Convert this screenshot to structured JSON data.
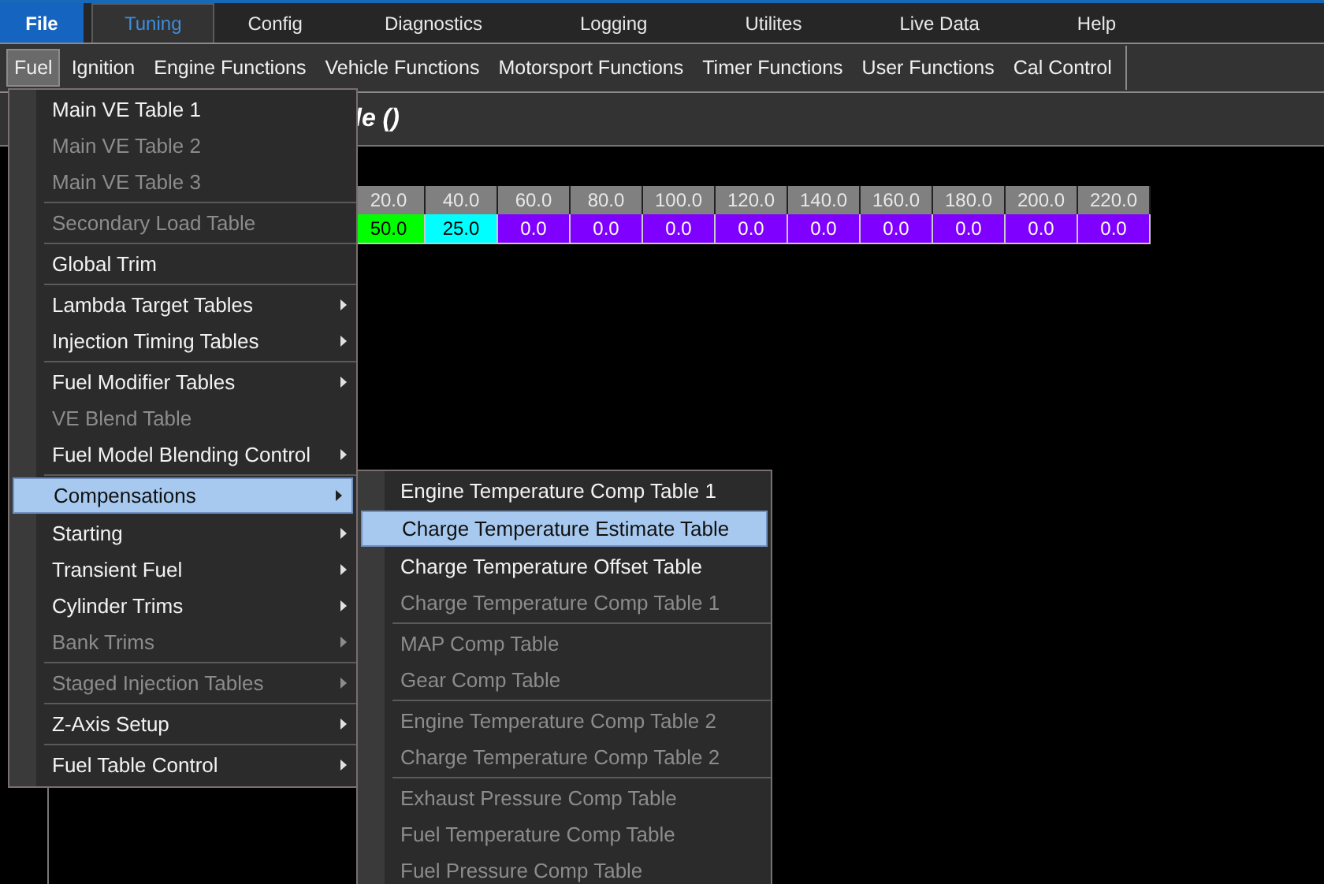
{
  "tabs": [
    {
      "label": "File",
      "kind": "file",
      "selected": false
    },
    {
      "label": "Tuning",
      "kind": "tab",
      "selected": true
    },
    {
      "label": "Config",
      "kind": "tab",
      "selected": false
    },
    {
      "label": "Diagnostics",
      "kind": "tab",
      "selected": false
    },
    {
      "label": "Logging",
      "kind": "tab",
      "selected": false
    },
    {
      "label": "Utilites",
      "kind": "tab",
      "selected": false
    },
    {
      "label": "Live Data",
      "kind": "tab",
      "selected": false
    },
    {
      "label": "Help",
      "kind": "tab",
      "selected": false
    }
  ],
  "ribbon": {
    "items": [
      {
        "label": "Fuel",
        "selected": true
      },
      {
        "label": "Ignition",
        "selected": false
      },
      {
        "label": "Engine Functions",
        "selected": false
      },
      {
        "label": "Vehicle Functions",
        "selected": false
      },
      {
        "label": "Motorsport Functions",
        "selected": false
      },
      {
        "label": "Timer Functions",
        "selected": false
      },
      {
        "label": "User Functions",
        "selected": false
      },
      {
        "label": "Cal Control",
        "selected": false
      }
    ]
  },
  "document": {
    "title": "le ()"
  },
  "table": {
    "columns": [
      "20.0",
      "40.0",
      "60.0",
      "80.0",
      "100.0",
      "120.0",
      "140.0",
      "160.0",
      "180.0",
      "200.0",
      "220.0"
    ],
    "cells": [
      {
        "value": "50.0",
        "color": "#00ff00"
      },
      {
        "value": "25.0",
        "color": "#00ffff"
      },
      {
        "value": "0.0",
        "color": "#8000ff"
      },
      {
        "value": "0.0",
        "color": "#8000ff"
      },
      {
        "value": "0.0",
        "color": "#8000ff"
      },
      {
        "value": "0.0",
        "color": "#8000ff"
      },
      {
        "value": "0.0",
        "color": "#8000ff"
      },
      {
        "value": "0.0",
        "color": "#8000ff"
      },
      {
        "value": "0.0",
        "color": "#8000ff"
      },
      {
        "value": "0.0",
        "color": "#8000ff"
      },
      {
        "value": "0.0",
        "color": "#8000ff"
      }
    ]
  },
  "fuel_menu": {
    "items": [
      {
        "kind": "item",
        "label": "Main VE Table 1",
        "disabled": false,
        "submenu": false,
        "selected": false
      },
      {
        "kind": "item",
        "label": "Main VE Table 2",
        "disabled": true,
        "submenu": false,
        "selected": false
      },
      {
        "kind": "item",
        "label": "Main VE Table 3",
        "disabled": true,
        "submenu": false,
        "selected": false
      },
      {
        "kind": "separator"
      },
      {
        "kind": "item",
        "label": "Secondary Load Table",
        "disabled": true,
        "submenu": false,
        "selected": false
      },
      {
        "kind": "separator"
      },
      {
        "kind": "item",
        "label": "Global Trim",
        "disabled": false,
        "submenu": false,
        "selected": false
      },
      {
        "kind": "separator"
      },
      {
        "kind": "item",
        "label": "Lambda Target Tables",
        "disabled": false,
        "submenu": true,
        "selected": false
      },
      {
        "kind": "item",
        "label": "Injection Timing Tables",
        "disabled": false,
        "submenu": true,
        "selected": false
      },
      {
        "kind": "separator"
      },
      {
        "kind": "item",
        "label": "Fuel Modifier Tables",
        "disabled": false,
        "submenu": true,
        "selected": false
      },
      {
        "kind": "item",
        "label": "VE Blend Table",
        "disabled": true,
        "submenu": false,
        "selected": false
      },
      {
        "kind": "item",
        "label": "Fuel Model Blending Control",
        "disabled": false,
        "submenu": true,
        "selected": false
      },
      {
        "kind": "separator"
      },
      {
        "kind": "item",
        "label": "Compensations",
        "disabled": false,
        "submenu": true,
        "selected": true
      },
      {
        "kind": "item",
        "label": "Starting",
        "disabled": false,
        "submenu": true,
        "selected": false
      },
      {
        "kind": "item",
        "label": "Transient Fuel",
        "disabled": false,
        "submenu": true,
        "selected": false
      },
      {
        "kind": "item",
        "label": "Cylinder Trims",
        "disabled": false,
        "submenu": true,
        "selected": false
      },
      {
        "kind": "item",
        "label": "Bank Trims",
        "disabled": true,
        "submenu": true,
        "selected": false
      },
      {
        "kind": "separator"
      },
      {
        "kind": "item",
        "label": "Staged Injection Tables",
        "disabled": true,
        "submenu": true,
        "selected": false
      },
      {
        "kind": "separator"
      },
      {
        "kind": "item",
        "label": "Z-Axis Setup",
        "disabled": false,
        "submenu": true,
        "selected": false
      },
      {
        "kind": "separator"
      },
      {
        "kind": "item",
        "label": "Fuel Table Control",
        "disabled": false,
        "submenu": true,
        "selected": false
      }
    ]
  },
  "compensations_menu": {
    "items": [
      {
        "kind": "item",
        "label": "Engine Temperature Comp Table 1",
        "disabled": false,
        "submenu": false,
        "selected": false
      },
      {
        "kind": "item",
        "label": "Charge Temperature Estimate Table",
        "disabled": false,
        "submenu": false,
        "selected": true
      },
      {
        "kind": "item",
        "label": "Charge Temperature Offset Table",
        "disabled": false,
        "submenu": false,
        "selected": false
      },
      {
        "kind": "item",
        "label": "Charge Temperature Comp Table 1",
        "disabled": true,
        "submenu": false,
        "selected": false
      },
      {
        "kind": "separator"
      },
      {
        "kind": "item",
        "label": "MAP Comp Table",
        "disabled": true,
        "submenu": false,
        "selected": false
      },
      {
        "kind": "item",
        "label": "Gear Comp Table",
        "disabled": true,
        "submenu": false,
        "selected": false
      },
      {
        "kind": "separator"
      },
      {
        "kind": "item",
        "label": "Engine Temperature Comp Table 2",
        "disabled": true,
        "submenu": false,
        "selected": false
      },
      {
        "kind": "item",
        "label": "Charge Temperature Comp Table 2",
        "disabled": true,
        "submenu": false,
        "selected": false
      },
      {
        "kind": "separator"
      },
      {
        "kind": "item",
        "label": "Exhaust Pressure Comp Table",
        "disabled": true,
        "submenu": false,
        "selected": false
      },
      {
        "kind": "item",
        "label": "Fuel Temperature Comp Table",
        "disabled": true,
        "submenu": false,
        "selected": false
      },
      {
        "kind": "item",
        "label": "Fuel Pressure Comp Table",
        "disabled": true,
        "submenu": false,
        "selected": false
      }
    ]
  }
}
